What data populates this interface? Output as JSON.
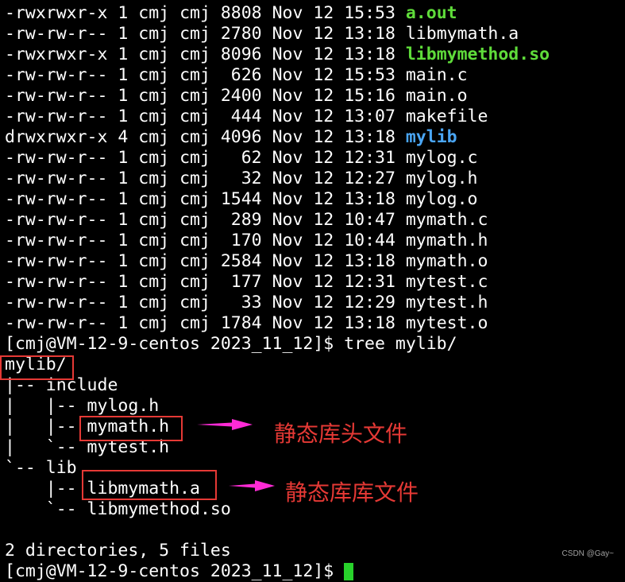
{
  "listing": [
    {
      "perms": "-rwxrwxr-x",
      "links": "1",
      "owner": "cmj",
      "group": "cmj",
      "size": "8808",
      "date": "Nov 12 15:53",
      "name": "a.out",
      "kind": "exec"
    },
    {
      "perms": "-rw-rw-r--",
      "links": "1",
      "owner": "cmj",
      "group": "cmj",
      "size": "2780",
      "date": "Nov 12 13:18",
      "name": "libmymath.a",
      "kind": "file"
    },
    {
      "perms": "-rwxrwxr-x",
      "links": "1",
      "owner": "cmj",
      "group": "cmj",
      "size": "8096",
      "date": "Nov 12 13:18",
      "name": "libmymethod.so",
      "kind": "exec"
    },
    {
      "perms": "-rw-rw-r--",
      "links": "1",
      "owner": "cmj",
      "group": "cmj",
      "size": "626",
      "date": "Nov 12 15:53",
      "name": "main.c",
      "kind": "file"
    },
    {
      "perms": "-rw-rw-r--",
      "links": "1",
      "owner": "cmj",
      "group": "cmj",
      "size": "2400",
      "date": "Nov 12 15:16",
      "name": "main.o",
      "kind": "file"
    },
    {
      "perms": "-rw-rw-r--",
      "links": "1",
      "owner": "cmj",
      "group": "cmj",
      "size": "444",
      "date": "Nov 12 13:07",
      "name": "makefile",
      "kind": "file"
    },
    {
      "perms": "drwxrwxr-x",
      "links": "4",
      "owner": "cmj",
      "group": "cmj",
      "size": "4096",
      "date": "Nov 12 13:18",
      "name": "mylib",
      "kind": "dir"
    },
    {
      "perms": "-rw-rw-r--",
      "links": "1",
      "owner": "cmj",
      "group": "cmj",
      "size": "62",
      "date": "Nov 12 12:31",
      "name": "mylog.c",
      "kind": "file"
    },
    {
      "perms": "-rw-rw-r--",
      "links": "1",
      "owner": "cmj",
      "group": "cmj",
      "size": "32",
      "date": "Nov 12 12:27",
      "name": "mylog.h",
      "kind": "file"
    },
    {
      "perms": "-rw-rw-r--",
      "links": "1",
      "owner": "cmj",
      "group": "cmj",
      "size": "1544",
      "date": "Nov 12 13:18",
      "name": "mylog.o",
      "kind": "file"
    },
    {
      "perms": "-rw-rw-r--",
      "links": "1",
      "owner": "cmj",
      "group": "cmj",
      "size": "289",
      "date": "Nov 12 10:47",
      "name": "mymath.c",
      "kind": "file"
    },
    {
      "perms": "-rw-rw-r--",
      "links": "1",
      "owner": "cmj",
      "group": "cmj",
      "size": "170",
      "date": "Nov 12 10:44",
      "name": "mymath.h",
      "kind": "file"
    },
    {
      "perms": "-rw-rw-r--",
      "links": "1",
      "owner": "cmj",
      "group": "cmj",
      "size": "2584",
      "date": "Nov 12 13:18",
      "name": "mymath.o",
      "kind": "file"
    },
    {
      "perms": "-rw-rw-r--",
      "links": "1",
      "owner": "cmj",
      "group": "cmj",
      "size": "177",
      "date": "Nov 12 12:31",
      "name": "mytest.c",
      "kind": "file"
    },
    {
      "perms": "-rw-rw-r--",
      "links": "1",
      "owner": "cmj",
      "group": "cmj",
      "size": "33",
      "date": "Nov 12 12:29",
      "name": "mytest.h",
      "kind": "file"
    },
    {
      "perms": "-rw-rw-r--",
      "links": "1",
      "owner": "cmj",
      "group": "cmj",
      "size": "1784",
      "date": "Nov 12 13:18",
      "name": "mytest.o",
      "kind": "file"
    }
  ],
  "prompt": "[cmj@VM-12-9-centos 2023_11_12]$ ",
  "command": "tree mylib/",
  "tree": [
    "mylib/",
    "|-- include",
    "|   |-- mylog.h",
    "|   |-- mymath.h",
    "|   `-- mytest.h",
    "`-- lib",
    "    |-- libmymath.a",
    "    `-- libmymethod.so"
  ],
  "summary": "2 directories, 5 files",
  "next_prompt": "[cmj@VM-12-9-centos 2023_11_12]$ ",
  "annotations": {
    "header_label": "静态库头文件",
    "lib_label": "静态库库文件"
  },
  "watermark": "CSDN @Gay~",
  "colors": {
    "exec": "#5fdc3a",
    "dir": "#4aa6f5",
    "annotation": "#e53935",
    "arrow": "#ff2bd6",
    "cursor": "#28d22b"
  }
}
